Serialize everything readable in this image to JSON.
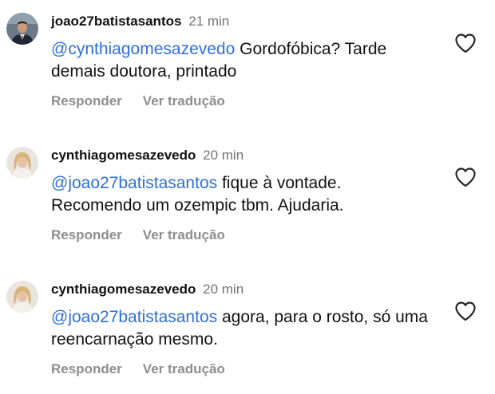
{
  "comments": [
    {
      "username": "joao27batistasantos",
      "time": "21 min",
      "mention": "@cynthiagomesazevedo",
      "text": " Gordofóbica? Tarde demais doutora, printado",
      "reply": "Responder",
      "translate": "Ver tradução",
      "avatar": "man-in-suit-avatar"
    },
    {
      "username": "cynthiagomesazevedo",
      "time": "20 min",
      "mention": "@joao27batistasantos",
      "text": " fique à vontade. Recomendo um ozempic tbm. Ajudaria.",
      "reply": "Responder",
      "translate": "Ver tradução",
      "avatar": "blonde-woman-avatar"
    },
    {
      "username": "cynthiagomesazevedo",
      "time": "20 min",
      "mention": "@joao27batistasantos",
      "text": " agora, para o rosto, só uma reencarnação mesmo.",
      "reply": "Responder",
      "translate": "Ver tradução",
      "avatar": "blonde-woman-avatar"
    }
  ],
  "icons": {
    "like": "heart-outline-icon"
  },
  "colors": {
    "mention": "#2f6fd9",
    "muted": "#8e8e8e",
    "text": "#111111"
  }
}
